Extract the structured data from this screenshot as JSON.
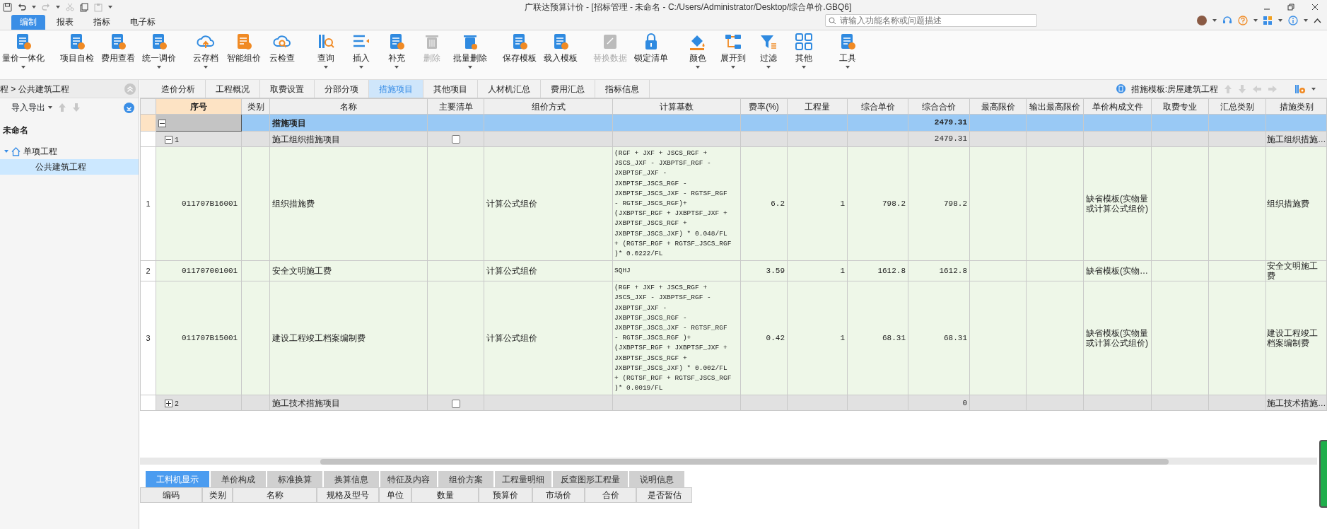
{
  "window": {
    "title": "广联达预算计价 - [招标管理 - 未命名 - C:/Users/Administrator/Desktop/综合单价.GBQ6]"
  },
  "menu_tabs": [
    {
      "label": "编制",
      "selected": true
    },
    {
      "label": "报表",
      "selected": false
    },
    {
      "label": "指标",
      "selected": false
    },
    {
      "label": "电子标",
      "selected": false
    }
  ],
  "search": {
    "placeholder": "请输入功能名称或问题描述"
  },
  "toolbar": [
    {
      "label": "量价一体化",
      "has_menu": true,
      "disabled": false
    },
    {
      "label": "项目自检",
      "has_menu": false,
      "disabled": false
    },
    {
      "label": "费用查看",
      "has_menu": false,
      "disabled": false
    },
    {
      "label": "统一调价",
      "has_menu": true,
      "disabled": false
    },
    {
      "label": "云存档",
      "has_menu": true,
      "disabled": false
    },
    {
      "label": "智能组价",
      "has_menu": false,
      "disabled": false
    },
    {
      "label": "云检查",
      "has_menu": false,
      "disabled": false
    },
    {
      "label": "查询",
      "has_menu": true,
      "disabled": false
    },
    {
      "label": "插入",
      "has_menu": true,
      "disabled": false
    },
    {
      "label": "补充",
      "has_menu": true,
      "disabled": false
    },
    {
      "label": "删除",
      "has_menu": false,
      "disabled": true
    },
    {
      "label": "批量删除",
      "has_menu": true,
      "disabled": false
    },
    {
      "label": "保存模板",
      "has_menu": false,
      "disabled": false
    },
    {
      "label": "载入模板",
      "has_menu": false,
      "disabled": false
    },
    {
      "label": "替换数据",
      "has_menu": false,
      "disabled": true
    },
    {
      "label": "锁定清单",
      "has_menu": false,
      "disabled": false
    },
    {
      "label": "颜色",
      "has_menu": true,
      "disabled": false
    },
    {
      "label": "展开到",
      "has_menu": true,
      "disabled": false
    },
    {
      "label": "过滤",
      "has_menu": true,
      "disabled": false
    },
    {
      "label": "其他",
      "has_menu": true,
      "disabled": false
    },
    {
      "label": "工具",
      "has_menu": true,
      "disabled": false
    }
  ],
  "sidebar": {
    "breadcrumb": "程 > 公共建筑工程",
    "import_export": "导入导出",
    "tree": [
      {
        "name": "未命名",
        "selected": false,
        "children": [
          {
            "name": "单项工程",
            "expanded": true,
            "selected": false,
            "children": [
              {
                "name": "公共建筑工程",
                "selected": true
              }
            ]
          }
        ]
      }
    ]
  },
  "view_tabs": [
    {
      "label": "造价分析",
      "selected": false
    },
    {
      "label": "工程概况",
      "selected": false
    },
    {
      "label": "取费设置",
      "selected": false
    },
    {
      "label": "分部分项",
      "selected": false
    },
    {
      "label": "措施项目",
      "selected": true
    },
    {
      "label": "其他项目",
      "selected": false
    },
    {
      "label": "人材机汇总",
      "selected": false
    },
    {
      "label": "费用汇总",
      "selected": false
    },
    {
      "label": "指标信息",
      "selected": false
    }
  ],
  "template_label": "措施模板:房屋建筑工程",
  "table": {
    "columns": [
      {
        "label": "序号",
        "selected": true
      },
      {
        "label": "类别",
        "selected": false
      },
      {
        "label": "名称",
        "selected": false
      },
      {
        "label": "主要清单",
        "selected": false
      },
      {
        "label": "组价方式",
        "selected": false
      },
      {
        "label": "计算基数",
        "selected": false
      },
      {
        "label": "费率(%)",
        "selected": false
      },
      {
        "label": "工程量",
        "selected": false
      },
      {
        "label": "综合单价",
        "selected": false
      },
      {
        "label": "综合合价",
        "selected": false
      },
      {
        "label": "最高限价",
        "selected": false
      },
      {
        "label": "输出最高限价",
        "selected": false
      },
      {
        "label": "单价构成文件",
        "selected": false
      },
      {
        "label": "取费专业",
        "selected": false
      },
      {
        "label": "汇总类别",
        "selected": false
      },
      {
        "label": "措施类别",
        "selected": false
      }
    ],
    "rows": [
      {
        "kind": "section",
        "expanded": true,
        "name": "措施项目",
        "total": "2479.31"
      },
      {
        "kind": "group",
        "expanded": true,
        "number": "1",
        "name": "施工组织措施项目",
        "main_list": false,
        "total": "2479.31",
        "measure_type": "施工组织措施…"
      },
      {
        "kind": "item",
        "row_number": "1",
        "code": "011707B16001",
        "name": "组织措施费",
        "method": "计算公式组价",
        "base": "(RGF + JXF + JSCS_RGF +\nJSCS_JXF - JXBPTSF_RGF -\nJXBPTSF_JXF -\nJXBPTSF_JSCS_RGF -\nJXBPTSF_JSCS_JXF - RGTSF_RGF\n- RGTSF_JSCS_RGF)+\n(JXBPTSF_RGF + JXBPTSF_JXF +\nJXBPTSF_JSCS_RGF +\nJXBPTSF_JSCS_JXF) * 0.048/FL\n+ (RGTSF_RGF + RGTSF_JSCS_RGF\n)* 0.0222/FL",
        "rate": "6.2",
        "quantity": "1",
        "unit_price": "798.2",
        "total": "798.2",
        "template": "缺省模板(实物量或计算公式组价)",
        "measure_type": "组织措施费"
      },
      {
        "kind": "item",
        "row_number": "2",
        "code": "011707001001",
        "name": "安全文明施工费",
        "method": "计算公式组价",
        "base": "SQHJ",
        "rate": "3.59",
        "quantity": "1",
        "unit_price": "1612.8",
        "total": "1612.8",
        "template": "缺省模板(实物…",
        "measure_type": "安全文明施工费"
      },
      {
        "kind": "item",
        "row_number": "3",
        "code": "011707B15001",
        "name": "建设工程竣工档案编制费",
        "method": "计算公式组价",
        "base": "(RGF + JXF + JSCS_RGF +\nJSCS_JXF - JXBPTSF_RGF -\nJXBPTSF_JXF -\nJXBPTSF_JSCS_RGF -\nJXBPTSF_JSCS_JXF - RGTSF_RGF\n- RGTSF_JSCS_RGF )+\n(JXBPTSF_RGF + JXBPTSF_JXF +\nJXBPTSF_JSCS_RGF +\nJXBPTSF_JSCS_JXF) * 0.002/FL\n+ (RGTSF_RGF + RGTSF_JSCS_RGF\n)* 0.0019/FL",
        "rate": "0.42",
        "quantity": "1",
        "unit_price": "68.31",
        "total": "68.31",
        "template": "缺省模板(实物量或计算公式组价)",
        "measure_type": "建设工程竣工档案编制费"
      },
      {
        "kind": "group",
        "expanded": false,
        "number": "2",
        "name": "施工技术措施项目",
        "main_list": false,
        "total": "0",
        "measure_type": "施工技术措施…"
      }
    ]
  },
  "detail_tabs": [
    {
      "label": "工料机显示",
      "selected": true
    },
    {
      "label": "单价构成",
      "selected": false
    },
    {
      "label": "标准换算",
      "selected": false
    },
    {
      "label": "换算信息",
      "selected": false
    },
    {
      "label": "特征及内容",
      "selected": false
    },
    {
      "label": "组价方案",
      "selected": false
    },
    {
      "label": "工程量明细",
      "selected": false
    },
    {
      "label": "反查图形工程量",
      "selected": false
    },
    {
      "label": "说明信息",
      "selected": false
    }
  ],
  "detail_columns": [
    "编码",
    "类别",
    "名称",
    "规格及型号",
    "单位",
    "数量",
    "预算价",
    "市场价",
    "合价",
    "是否暂估"
  ]
}
